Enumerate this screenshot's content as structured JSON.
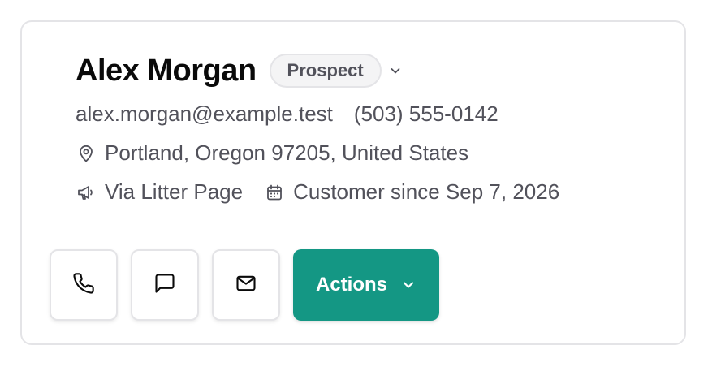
{
  "contact": {
    "name": "Alex Morgan",
    "status": "Prospect",
    "email": "alex.morgan@example.test",
    "phone": "(503) 555-0142",
    "location": "Portland, Oregon 97205, United States",
    "source": "Via Litter Page",
    "customer_since": "Customer since Sep 7, 2026"
  },
  "actions": {
    "label": "Actions"
  },
  "icons": {
    "status_dropdown": "chevron-down-icon",
    "location": "map-pin-icon",
    "source": "megaphone-icon",
    "customer_since": "calendar-icon",
    "call": "phone-icon",
    "message": "message-square-icon",
    "email": "mail-icon",
    "actions_dropdown": "chevron-down-icon"
  },
  "colors": {
    "accent": "#149784",
    "text_primary": "#0a0a0a",
    "text_secondary": "#52525b",
    "border": "#e4e4e7",
    "badge_bg": "#f4f4f5"
  }
}
